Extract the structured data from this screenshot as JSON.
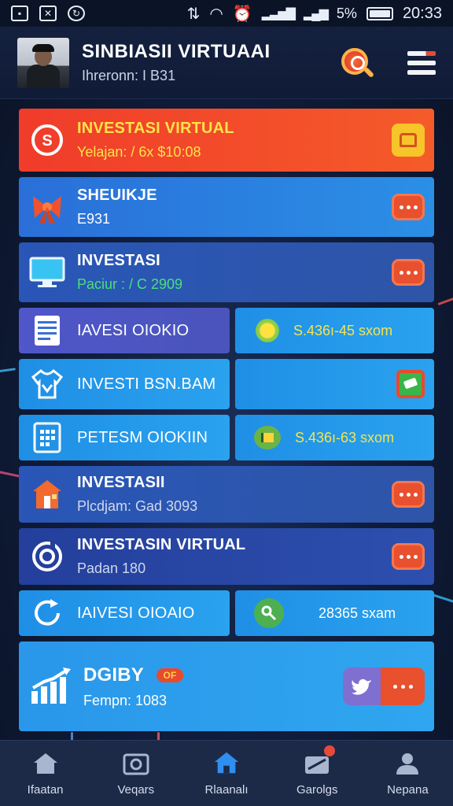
{
  "status_bar": {
    "battery_text": "5%",
    "time": "20:33"
  },
  "header": {
    "title": "SINBIASII VIRTUAAI",
    "subtitle": "Ihreronn: I B31"
  },
  "rows": {
    "featured": {
      "title": "INVESTASI VIRTUAL",
      "subtitle": "Yelajan: / 6x $10:08",
      "icon": "slot-coin-icon",
      "action_icon": "wallet-icon"
    },
    "r1": {
      "title": "SHEUIKJE",
      "subtitle": "E931",
      "icon": "gift-bow-icon"
    },
    "r2": {
      "title": "INVESTASI",
      "subtitle": "Paciur : / C 2909",
      "icon": "monitor-icon"
    },
    "r3": {
      "left": "IAVESI OIOKIO",
      "right": "S.436ı-45 sxom",
      "icon": "notepad-icon"
    },
    "r4": {
      "left": "INVESTI BSN.BAM",
      "icon": "shirt-icon"
    },
    "r5": {
      "left": "PETESM OIOKIIN",
      "right": "S.436ı-63 sxom",
      "icon": "calculator-icon"
    },
    "r6": {
      "title": "INVESTASII",
      "subtitle": "Plcdjam: Gad 3093",
      "icon": "house-icon"
    },
    "r7": {
      "title": "INVESTASIN VIRTUAL",
      "subtitle": "Padan 180",
      "icon": "target-icon"
    },
    "r8": {
      "left": "IAIVESI OIOAIO",
      "right": "28365 sxam",
      "icon": "refresh-icon"
    },
    "r9": {
      "title": "DGIBY",
      "tag": "OF",
      "subtitle": "Fempn: 1083",
      "icon": "growth-chart-icon"
    }
  },
  "nav": [
    {
      "label": "Ifaatan",
      "icon": "home-icon"
    },
    {
      "label": "Veqars",
      "icon": "camera-icon"
    },
    {
      "label": "Rlaanalı",
      "icon": "home-active-icon"
    },
    {
      "label": "Garolgs",
      "icon": "ticket-icon"
    },
    {
      "label": "Nepana",
      "icon": "profile-icon"
    }
  ],
  "colors": {
    "accent_orange": "#f04a2a",
    "active_nav": "#2f8ff0",
    "value_yellow": "#f4e44e"
  }
}
